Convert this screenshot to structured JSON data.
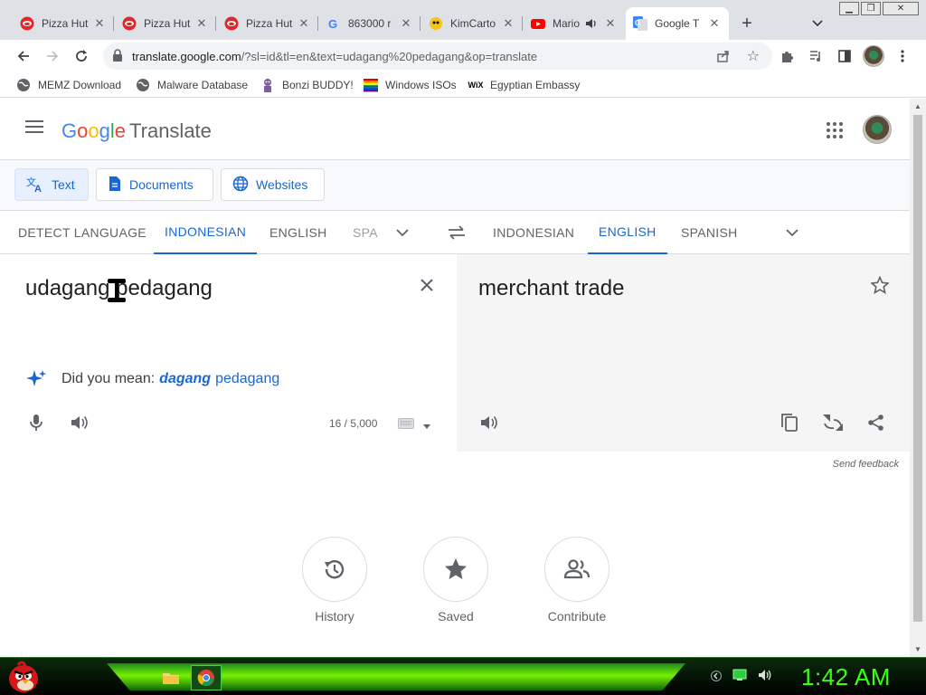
{
  "browser": {
    "tabs": [
      {
        "title": "Pizza Hut",
        "icon": "pizza-hut-favicon"
      },
      {
        "title": "Pizza Hut",
        "icon": "pizza-hut-favicon"
      },
      {
        "title": "Pizza Hut",
        "icon": "pizza-hut-favicon"
      },
      {
        "title": "863000 r",
        "icon": "google-favicon"
      },
      {
        "title": "KimCarto",
        "icon": "kimcartoon-favicon"
      },
      {
        "title": "Mario",
        "icon": "youtube-favicon",
        "audio": true
      },
      {
        "title": "Google T",
        "icon": "google-translate-favicon",
        "active": true
      }
    ],
    "url": {
      "host": "translate.google.com",
      "path": "/?sl=id&tl=en&text=udagang%20pedagang&op=translate"
    },
    "bookmarks": [
      {
        "label": "MEMZ Download",
        "icon": "globe-icon"
      },
      {
        "label": "Malware Database",
        "icon": "globe-icon"
      },
      {
        "label": "Bonzi BUDDY!",
        "icon": "bonzi-icon"
      },
      {
        "label": "Windows ISOs",
        "icon": "rainbow-flag-icon"
      },
      {
        "label": "Egyptian Embassy",
        "icon": "wix-icon",
        "icon_text": "WiX"
      }
    ]
  },
  "translate": {
    "logo": {
      "google": "Google",
      "product": "Translate"
    },
    "modes": [
      "Text",
      "Documents",
      "Websites"
    ],
    "active_mode": "Text",
    "source_langs": [
      "DETECT LANGUAGE",
      "INDONESIAN",
      "ENGLISH",
      "SPA"
    ],
    "source_active": "INDONESIAN",
    "target_langs": [
      "INDONESIAN",
      "ENGLISH",
      "SPANISH"
    ],
    "target_active": "ENGLISH",
    "source_text": "udagang pedagang",
    "target_text": "merchant trade",
    "did_you_mean": {
      "prefix": "Did you mean:",
      "correction": "dagang",
      "rest": "pedagang"
    },
    "char_count": "16 / 5,000",
    "send_feedback": "Send feedback",
    "bottom_buttons": [
      "History",
      "Saved",
      "Contribute"
    ]
  },
  "taskbar": {
    "clock": "1:42 AM"
  },
  "colors": {
    "accent": "#1967d2",
    "clock": "#39ff14"
  }
}
